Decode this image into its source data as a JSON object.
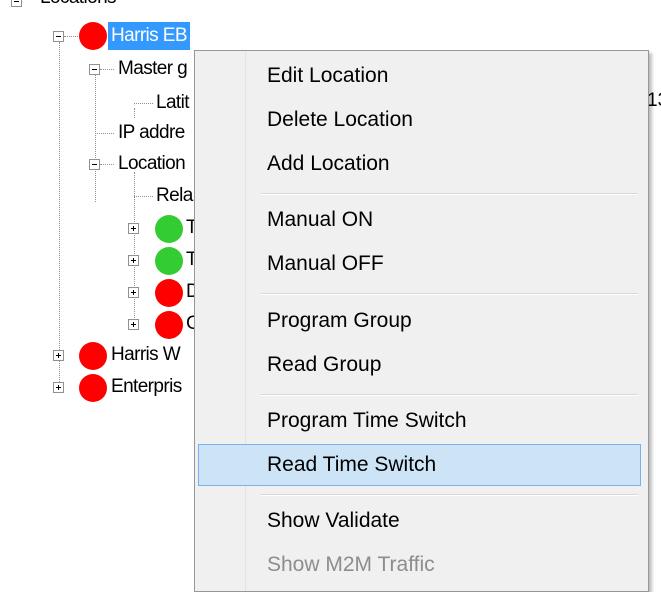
{
  "tree": {
    "root_label": "Locations",
    "nodes": [
      {
        "id": "harris-eb",
        "label": "Harris EB",
        "status": "red",
        "selected": true
      },
      {
        "id": "master-group",
        "label": "Master g"
      },
      {
        "id": "latitude",
        "label": "Latit"
      },
      {
        "id": "ip-address",
        "label": "IP addre"
      },
      {
        "id": "locations",
        "label": "Location"
      },
      {
        "id": "relays",
        "label": "Rela"
      },
      {
        "id": "child-1",
        "label": "T",
        "status": "green"
      },
      {
        "id": "child-2",
        "label": "T",
        "status": "green"
      },
      {
        "id": "child-3",
        "label": "D",
        "status": "red"
      },
      {
        "id": "child-4",
        "label": "C",
        "status": "red"
      },
      {
        "id": "harris-w",
        "label": "Harris W",
        "status": "red"
      },
      {
        "id": "enterprise",
        "label": "Enterpris",
        "status": "red"
      }
    ],
    "partial_value": "13"
  },
  "context_menu": {
    "groups": [
      [
        "Edit Location",
        "Delete Location",
        "Add Location"
      ],
      [
        "Manual ON",
        "Manual OFF"
      ],
      [
        "Program Group",
        "Read Group"
      ],
      [
        "Program Time Switch",
        "Read Time Switch"
      ],
      [
        "Show Validate",
        "Show M2M Traffic"
      ]
    ],
    "highlighted": "Read Time Switch",
    "disabled": [
      "Show M2M Traffic"
    ]
  },
  "colors": {
    "selection": "#3399ff",
    "status_red": "#ff0000",
    "status_green": "#33cc33",
    "menu_highlight": "#cde4f7",
    "menu_highlight_border": "#7ab1e6"
  }
}
